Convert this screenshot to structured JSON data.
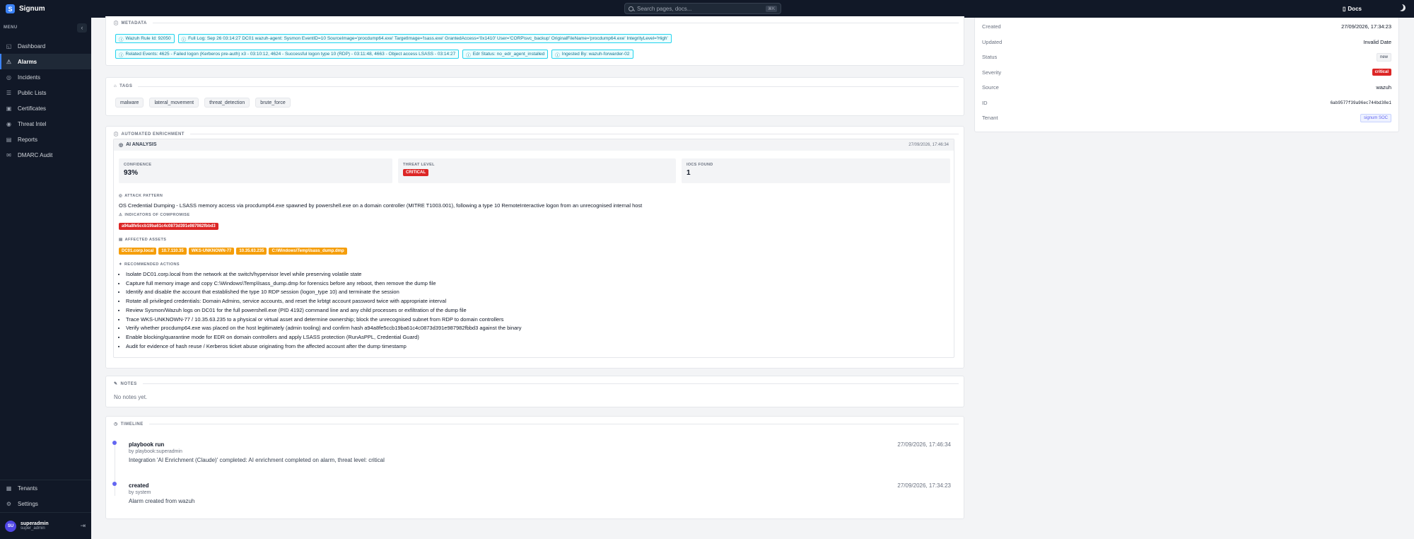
{
  "app": {
    "name": "Signum"
  },
  "search": {
    "placeholder": "Search pages, docs...",
    "shortcut": "⌘K"
  },
  "header": {
    "docs_label": "Docs"
  },
  "sidebar": {
    "menu_label": "MENU",
    "items": [
      {
        "label": "Dashboard",
        "icon": "dashboard-icon"
      },
      {
        "label": "Alarms",
        "icon": "alarm-icon",
        "active": true
      },
      {
        "label": "Incidents",
        "icon": "incident-icon"
      },
      {
        "label": "Public Lists",
        "icon": "list-icon"
      },
      {
        "label": "Certificates",
        "icon": "certificate-icon"
      },
      {
        "label": "Threat Intel",
        "icon": "eye-icon"
      },
      {
        "label": "Reports",
        "icon": "report-icon"
      },
      {
        "label": "DMARC Audit",
        "icon": "mail-icon"
      }
    ],
    "bottom_items": [
      {
        "label": "Tenants",
        "icon": "building-icon"
      },
      {
        "label": "Settings",
        "icon": "gear-icon"
      }
    ],
    "user": {
      "initials": "SU",
      "name": "superadmin",
      "role": "super_admin"
    }
  },
  "metadata": {
    "title": "METADATA",
    "chips_row1": [
      "Wazuh Rule Id: 92050",
      "Full Log: Sep 26 03:14:27 DC01 wazuh-agent: Sysmon EventID=10 SourceImage='procdump64.exe' TargetImage='lsass.exe' GrantedAccess='0x1410' User='CORP\\svc_backup' OriginalFileName='procdump64.exe' IntegrityLevel='High'"
    ],
    "chips_row2": [
      "Related Events: 4625 - Failed logon (Kerberos pre-auth) x3 - 03:10:12, 4624 - Successful logon type 10 (RDP) - 03:11:48, 4663 - Object access LSASS - 03:14:27",
      "Edr Status: no_edr_agent_installed",
      "Ingested By: wazuh-forwarder-02"
    ]
  },
  "tags": {
    "title": "TAGS",
    "items": [
      "malware",
      "lateral_movement",
      "threat_detection",
      "brute_force"
    ]
  },
  "enrichment": {
    "title": "AUTOMATED ENRICHMENT",
    "ai_title": "AI ANALYSIS",
    "timestamp": "27/09/2026, 17:46:34",
    "confidence_label": "CONFIDENCE",
    "confidence_value": "93%",
    "threat_label": "THREAT LEVEL",
    "threat_value": "CRITICAL",
    "iocs_label": "IOCS FOUND",
    "iocs_value": "1",
    "attack_label": "ATTACK PATTERN",
    "attack_text": "OS Credential Dumping - LSASS memory access via procdump64.exe spawned by powershell.exe on a domain controller (MITRE T1003.001), following a type 10 RemoteInteractive logon from an unrecognised internal host",
    "ioc_label": "INDICATORS OF COMPROMISE",
    "iocs": [
      "a94a8fe5ccb19ba61c4c0873d391e987982fbbd3"
    ],
    "assets_label": "AFFECTED ASSETS",
    "assets": [
      "DC01.corp.local",
      "10.7.110.35",
      "WKS-UNKNOWN-77",
      "10.35.63.235",
      "C:\\Windows\\Temp\\lsass_dump.dmp"
    ],
    "rec_label": "RECOMMENDED ACTIONS",
    "recommendations": [
      "Isolate DC01.corp.local from the network at the switch/hypervisor level while preserving volatile state",
      "Capture full memory image and copy C:\\Windows\\Temp\\lsass_dump.dmp for forensics before any reboot, then remove the dump file",
      "Identify and disable the account that established the type 10 RDP session (logon_type 10) and terminate the session",
      "Rotate all privileged credentials: Domain Admins, service accounts, and reset the krbtgt account password twice with appropriate interval",
      "Review Sysmon/Wazuh logs on DC01 for the full powershell.exe (PID 4192) command line and any child processes or exfiltration of the dump file",
      "Trace WKS-UNKNOWN-77 / 10.35.63.235 to a physical or virtual asset and determine ownership; block the unrecognised subnet from RDP to domain controllers",
      "Verify whether procdump64.exe was placed on the host legitimately (admin tooling) and confirm hash a94a8fe5ccb19ba61c4c0873d391e987982fbbd3 against the binary",
      "Enable blocking/quarantine mode for EDR on domain controllers and apply LSASS protection (RunAsPPL, Credential Guard)",
      "Audit for evidence of hash reuse / Kerberos ticket abuse originating from the affected account after the dump timestamp"
    ]
  },
  "notes": {
    "title": "NOTES",
    "empty": "No notes yet."
  },
  "timeline": {
    "title": "TIMELINE",
    "events": [
      {
        "title": "playbook run",
        "by": "by playbook:superadmin",
        "desc": "Integration 'AI Enrichment (Claude)' completed: AI enrichment completed on alarm, threat level: critical",
        "time": "27/09/2026, 17:46:34"
      },
      {
        "title": "created",
        "by": "by system",
        "desc": "Alarm created from wazuh",
        "time": "27/09/2026, 17:34:23"
      }
    ]
  },
  "details": {
    "rows": [
      {
        "label": "Created",
        "value": "27/09/2026, 17:34:23"
      },
      {
        "label": "Updated",
        "value": "Invalid Date"
      },
      {
        "label": "Status",
        "value": "new"
      },
      {
        "label": "Severity",
        "value": "critical"
      },
      {
        "label": "Source",
        "value": "wazuh"
      },
      {
        "label": "ID",
        "value": "6ab9577f39a96ec744bd38e1"
      },
      {
        "label": "Tenant",
        "value": "signum SOC"
      }
    ]
  },
  "colors": {
    "accent": "#3b82f6",
    "critical": "#dc2626",
    "asset": "#f59e0b",
    "chip": "#22d3ee",
    "sidebar": "#111827"
  }
}
